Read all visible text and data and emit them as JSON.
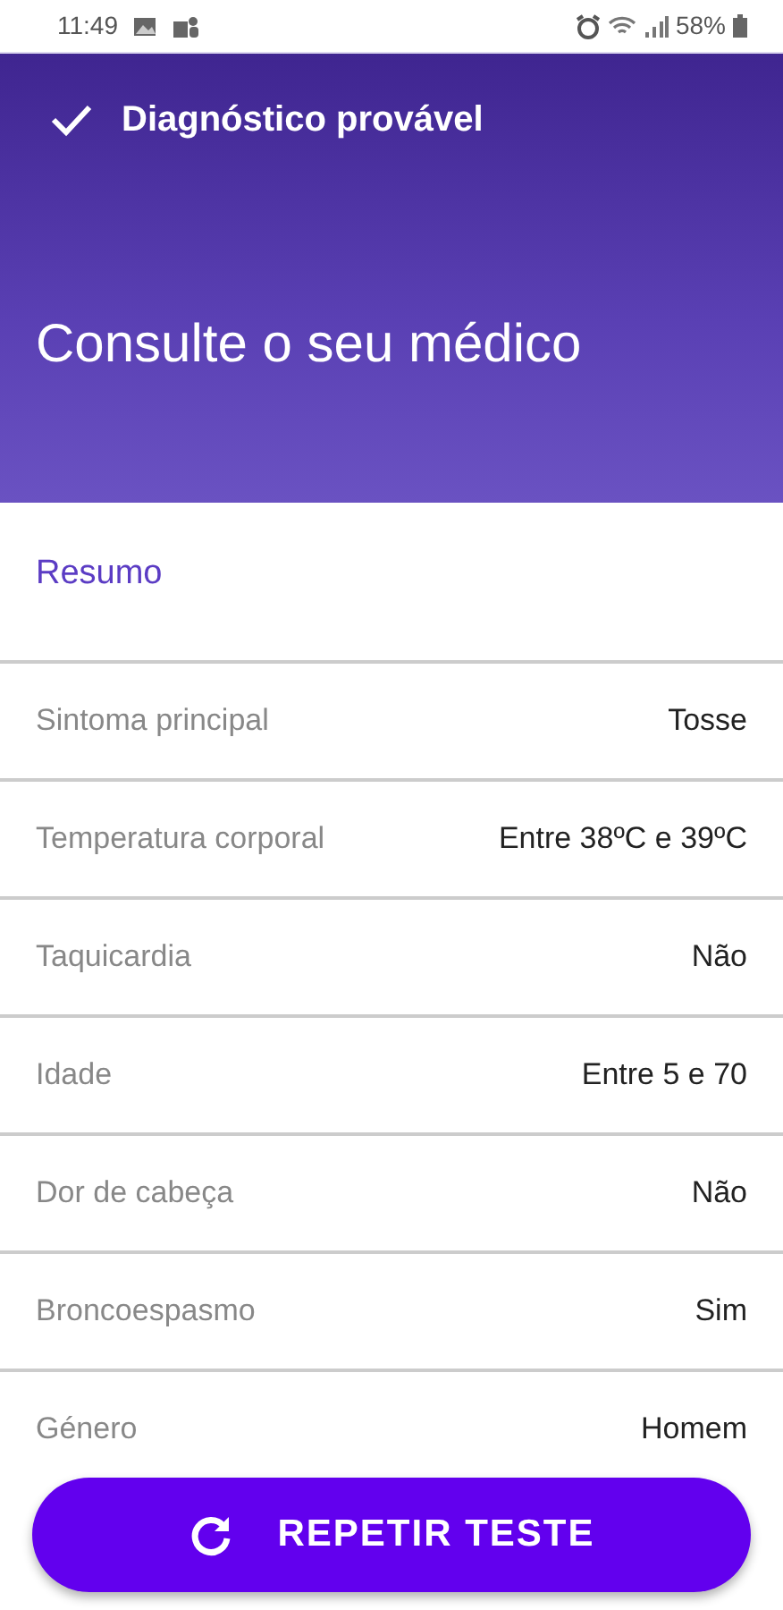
{
  "status_bar": {
    "time": "11:49",
    "battery": "58%"
  },
  "header": {
    "title": "Diagnóstico provável",
    "result": "Consulte o seu médico"
  },
  "summary": {
    "title": "Resumo"
  },
  "rows": [
    {
      "label": "Sintoma principal",
      "value": "Tosse"
    },
    {
      "label": "Temperatura corporal",
      "value": "Entre 38ºC e 39ºC"
    },
    {
      "label": "Taquicardia",
      "value": "Não"
    },
    {
      "label": "Idade",
      "value": "Entre 5 e 70"
    },
    {
      "label": "Dor de cabeça",
      "value": "Não"
    },
    {
      "label": "Broncoespasmo",
      "value": "Sim"
    },
    {
      "label": "Género",
      "value": "Homem"
    }
  ],
  "button": {
    "label": "REPETIR TESTE"
  }
}
